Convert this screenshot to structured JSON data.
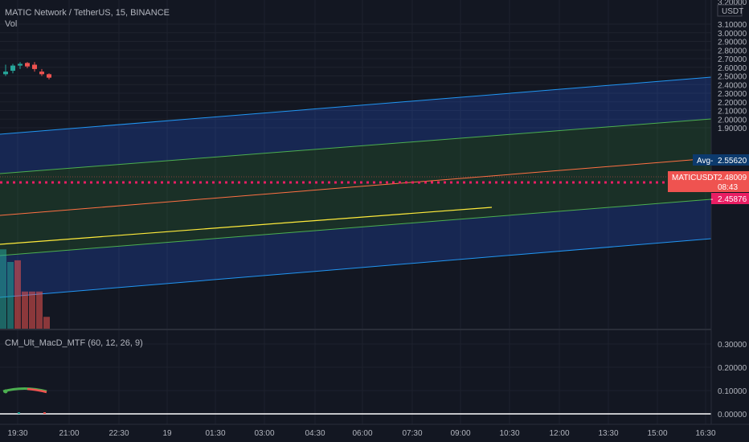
{
  "header": {
    "symbol_title": "MATIC Network / TetherUS, 15, BINANCE",
    "volume_label": "Vol",
    "indicator_title": "CM_Ult_MacD_MTF (60, 12, 26, 9)"
  },
  "price_axis": {
    "currency": "USDT",
    "top_partial": "3.20000",
    "ticks": [
      "3.10000",
      "3.00000",
      "2.90000",
      "2.80000",
      "2.70000",
      "2.60000",
      "2.50000",
      "2.40000",
      "2.30000",
      "2.20000",
      "2.10000",
      "2.00000",
      "1.90000"
    ]
  },
  "indicator_axis": {
    "ticks": [
      "0.30000",
      "0.20000",
      "0.10000",
      "0.00000"
    ]
  },
  "time_axis": {
    "ticks": [
      "19:30",
      "21:00",
      "22:30",
      "19",
      "01:30",
      "03:00",
      "04:30",
      "06:00",
      "07:30",
      "09:00",
      "10:30",
      "12:00",
      "13:30",
      "15:00",
      "16:30"
    ]
  },
  "price_tags": {
    "avg": {
      "label": "Avg",
      "value": "2.55620",
      "color": "#0c3a6d"
    },
    "current": {
      "label": "MATICUSDT",
      "value": "2.48009",
      "countdown": "08:43",
      "color": "#ef5350"
    },
    "line": {
      "value": "2.45876",
      "color": "#e91e63"
    }
  },
  "colors": {
    "background": "#131722",
    "grid": "#1e222d",
    "up": "#26a69a",
    "down": "#ef5350",
    "outer_channel": "#2196f3",
    "inner_channel": "#4caf50",
    "median": "#ff7043",
    "trend": "#ffeb3b"
  },
  "chart_data": {
    "type": "candlestick",
    "candles": [
      {
        "o": 2.52,
        "h": 2.63,
        "l": 2.5,
        "c": 2.55
      },
      {
        "o": 2.56,
        "h": 2.64,
        "l": 2.53,
        "c": 2.62
      },
      {
        "o": 2.62,
        "h": 2.66,
        "l": 2.58,
        "c": 2.64
      },
      {
        "o": 2.65,
        "h": 2.66,
        "l": 2.59,
        "c": 2.61
      },
      {
        "o": 2.63,
        "h": 2.66,
        "l": 2.55,
        "c": 2.58
      },
      {
        "o": 2.55,
        "h": 2.58,
        "l": 2.5,
        "c": 2.52
      },
      {
        "o": 2.52,
        "h": 2.53,
        "l": 2.46,
        "c": 2.48
      }
    ],
    "volume_bars": [
      {
        "value": 0.95,
        "up": true
      },
      {
        "value": 0.8,
        "up": true
      },
      {
        "value": 0.82,
        "up": false
      },
      {
        "value": 0.45,
        "up": false
      },
      {
        "value": 0.45,
        "up": false
      },
      {
        "value": 0.45,
        "up": false
      },
      {
        "value": 0.15,
        "up": false
      }
    ],
    "avg_price": 2.5562,
    "last_price": 2.48009,
    "price_line": 2.45876
  }
}
